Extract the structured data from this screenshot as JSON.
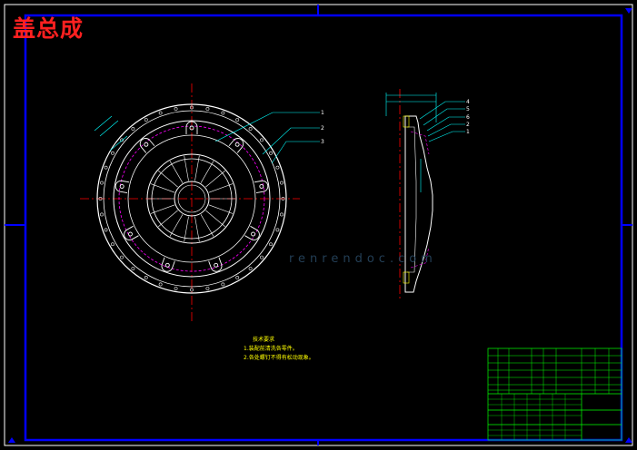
{
  "drawing": {
    "title": "盖总成",
    "tech_notes": {
      "heading": "技术要求",
      "items": [
        "1.装配前清洗各零件。",
        "2.各处螺钉不得有松动现象。"
      ]
    },
    "callouts_front": [
      "1",
      "2",
      "3"
    ],
    "callouts_side": [
      "4",
      "5",
      "6",
      "2",
      "1"
    ],
    "watermark": "renrendoc.com"
  },
  "colors": {
    "background": "#000000",
    "frame": "#0000ff",
    "part_outline": "#ffffff",
    "centerline": "#ff0000",
    "leader": "#00ffff",
    "hidden_line": "#ff00ff",
    "title_block": "#00ff00",
    "title_text": "#ff2020"
  }
}
